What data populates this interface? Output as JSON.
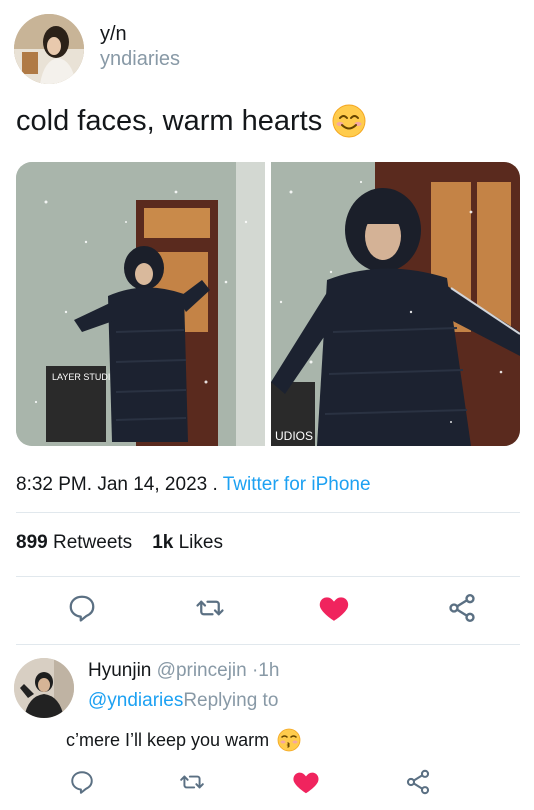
{
  "tweet": {
    "display_name": "y/n",
    "handle": "yndiaries",
    "text": "cold faces, warm hearts",
    "emoji": "smiling-face-with-smiling-eyes-emoji",
    "time": "8:32 PM",
    "date": "Jan 14, 2023",
    "source": "Twitter for iPhone",
    "retweets_count": "899",
    "retweets_label": "Retweets",
    "likes_count": "1k",
    "likes_label": "Likes"
  },
  "media": {
    "images": [
      {
        "name": "photo-puffer-coat-left"
      },
      {
        "name": "photo-puffer-coat-right"
      }
    ],
    "left_sign": "LAYER STUDIOS",
    "right_sign": "UDIOS"
  },
  "actions": {
    "reply_icon": "reply-icon",
    "retweet_icon": "retweet-icon",
    "like_icon": "heart-icon",
    "share_icon": "share-icon",
    "like_color": "#f0245e"
  },
  "reply": {
    "display_name": "Hyunjin",
    "handle": "@princejin",
    "time": "·1h",
    "mention": "@yndiaries",
    "replying_to": "Replying to",
    "text": "c’mere I’ll keep you warm",
    "emoji": "kissing-face-with-smiling-eyes-emoji"
  },
  "colors": {
    "accent": "#1da1f2",
    "muted": "#8899a6",
    "text": "#14171a",
    "divider": "#e1e8ed"
  }
}
